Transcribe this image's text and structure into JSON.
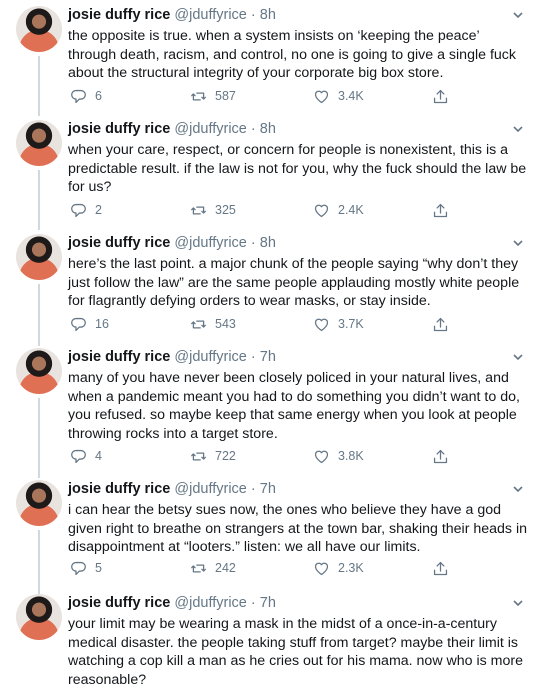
{
  "tweets": [
    {
      "name": "josie duffy rice",
      "handle": "@jduffyrice",
      "separator": "·",
      "time": "8h",
      "text": "the opposite is true. when a system insists on ‘keeping the peace’ through death, racism, and control, no one is going to give a single fuck about the structural integrity of your corporate big box store.",
      "replies": "6",
      "retweets": "587",
      "likes": "3.4K"
    },
    {
      "name": "josie duffy rice",
      "handle": "@jduffyrice",
      "separator": "·",
      "time": "8h",
      "text": "when your care, respect, or concern for people is nonexistent, this is a predictable result. if the law is not for you, why the fuck should the law be for us?",
      "replies": "2",
      "retweets": "325",
      "likes": "2.4K"
    },
    {
      "name": "josie duffy rice",
      "handle": "@jduffyrice",
      "separator": "·",
      "time": "8h",
      "text": "here’s the last point. a major chunk of the people saying “why don’t they just follow the law” are the same people applauding mostly white people for flagrantly defying orders to wear masks, or stay inside.",
      "replies": "16",
      "retweets": "543",
      "likes": "3.7K"
    },
    {
      "name": "josie duffy rice",
      "handle": "@jduffyrice",
      "separator": "·",
      "time": "7h",
      "text": "many of you have never been closely policed in your natural lives, and when a pandemic meant you had to do something you didn’t want to do, you refused. so maybe keep that same energy when you look at people throwing rocks into a target store.",
      "replies": "4",
      "retweets": "722",
      "likes": "3.8K"
    },
    {
      "name": "josie duffy rice",
      "handle": "@jduffyrice",
      "separator": "·",
      "time": "7h",
      "text": "i can hear the betsy sues now, the ones who believe they have a god given right to breathe on strangers at the town bar, shaking their heads in disappointment at “looters.” listen: we all have our limits.",
      "replies": "5",
      "retweets": "242",
      "likes": "2.3K"
    },
    {
      "name": "josie duffy rice",
      "handle": "@jduffyrice",
      "separator": "·",
      "time": "7h",
      "text": "your limit may be wearing a mask in the midst of a once-in-a-century medical disaster. the people taking stuff from target? maybe their limit is watching a cop kill a man as he cries out for his mama. now who is more reasonable?",
      "replies": "",
      "retweets": "",
      "likes": ""
    }
  ],
  "icons": {
    "reply": "reply-icon",
    "retweet": "retweet-icon",
    "like": "heart-icon",
    "share": "share-icon",
    "more": "chevron-down-icon"
  },
  "colors": {
    "text": "#14171a",
    "secondary": "#657786",
    "thread": "#cfd9de"
  }
}
